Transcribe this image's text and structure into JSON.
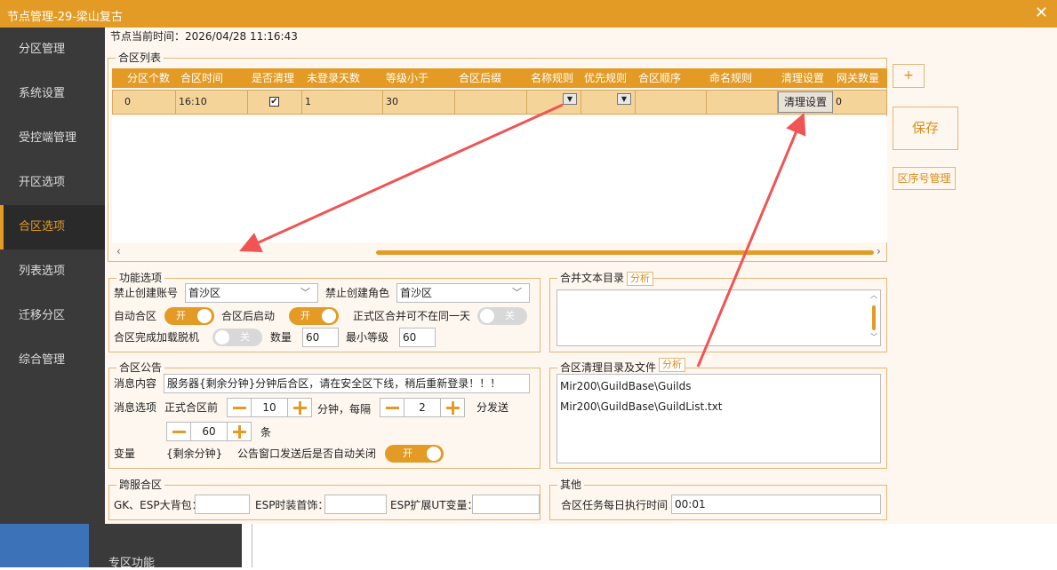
{
  "window": {
    "title": "节点管理-29-梁山复古"
  },
  "sidebar": {
    "items": [
      {
        "label": "分区管理"
      },
      {
        "label": "系统设置"
      },
      {
        "label": "受控端管理"
      },
      {
        "label": "开区选项"
      },
      {
        "label": "合区选项"
      },
      {
        "label": "列表选项"
      },
      {
        "label": "迁移分区"
      },
      {
        "label": "综合管理"
      }
    ],
    "active_index": 4,
    "bottom_label": "专区功能"
  },
  "header": {
    "time_label": "节点当前时间：2026/04/28 11:16:43"
  },
  "merge_list": {
    "title": "合区列表",
    "columns": [
      "分区个数",
      "合区时间",
      "是否清理",
      "未登录天数",
      "等级小于",
      "合区后缀",
      "名称规则",
      "优先规则",
      "合区顺序",
      "命名规则",
      "清理设置",
      "网关数量"
    ],
    "row": {
      "count": "0",
      "time": "16:10",
      "cleanup_checked": "✔",
      "days": "1",
      "level": "30",
      "suffix": "",
      "cleanup_button": "清理设置",
      "gateway": "0"
    }
  },
  "right_buttons": {
    "add": "+",
    "save": "保存",
    "seq": "区序号管理"
  },
  "func": {
    "title": "功能选项",
    "ban_account_label": "禁止创建账号",
    "ban_account_value": "首沙区",
    "ban_role_label": "禁止创建角色",
    "ban_role_value": "首沙区",
    "auto_merge_label": "自动合区",
    "auto_merge_toggle": "开",
    "after_start_label": "合区后启动",
    "after_start_toggle": "开",
    "not_same_day_label": "正式区合并可不在同一天",
    "not_same_day_toggle": "关",
    "offline_label": "合区完成加载脱机",
    "offline_toggle": "关",
    "qty_label": "数量",
    "qty_value": "60",
    "min_level_label": "最小等级",
    "min_level_value": "60"
  },
  "merge_text": {
    "title": "合并文本目录",
    "analyze": "分析"
  },
  "notice": {
    "title": "合区公告",
    "msg_label": "消息内容",
    "msg_value": "服务器{剩余分钟}分钟后合区，请在安全区下线，稍后重新登录！！！",
    "options_label": "消息选项",
    "before_label": "正式合区前",
    "before_value": "10",
    "minute_every_label": "分钟，每隔",
    "every_value": "2",
    "send_label": "分发送",
    "count_value": "60",
    "count_unit": "条",
    "var_label": "变量",
    "var_value": "{剩余分钟}",
    "autoclose_label": "公告窗口发送后是否自动关闭",
    "autoclose_toggle": "开"
  },
  "cleanup_dir": {
    "title": "合区清理目录及文件",
    "analyze": "分析",
    "lines": [
      "Mir200\\GuildBase\\Guilds",
      "Mir200\\GuildBase\\GuildList.txt"
    ]
  },
  "cross": {
    "title": "跨服合区",
    "gk_label": "GK、ESP大背包：",
    "fashion_label": "ESP时装首饰：",
    "ut_label": "ESP扩展UT变量："
  },
  "other": {
    "title": "其他",
    "exec_label": "合区任务每日执行时间",
    "exec_value": "00:01"
  },
  "colors": {
    "accent": "#e39b25",
    "sidebar": "#3a3a3a",
    "arrow": "#f05454"
  }
}
